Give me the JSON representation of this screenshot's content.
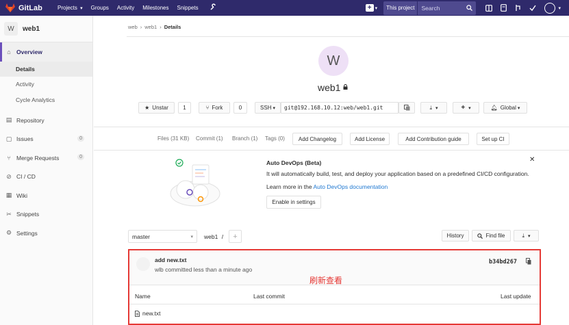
{
  "navbar": {
    "brand": "GitLab",
    "links": [
      "Projects",
      "Groups",
      "Activity",
      "Milestones",
      "Snippets"
    ],
    "scope": "This project",
    "search_placeholder": "Search",
    "bg_color": "#2f2a6b"
  },
  "sidebar": {
    "project_initial": "W",
    "project_name": "web1",
    "overview": "Overview",
    "sub_items": [
      "Details",
      "Activity",
      "Cycle Analytics"
    ],
    "items": [
      {
        "label": "Repository",
        "icon": "book-icon"
      },
      {
        "label": "Issues",
        "icon": "issues-icon",
        "count": "0"
      },
      {
        "label": "Merge Requests",
        "icon": "merge-request-icon",
        "count": "0"
      },
      {
        "label": "CI / CD",
        "icon": "rocket-icon"
      },
      {
        "label": "Wiki",
        "icon": "wiki-icon"
      },
      {
        "label": "Snippets",
        "icon": "scissors-icon"
      },
      {
        "label": "Settings",
        "icon": "gear-icon"
      }
    ]
  },
  "breadcrumb": [
    "web",
    "web1",
    "Details"
  ],
  "project": {
    "initial": "W",
    "title": "web1"
  },
  "actions": {
    "star_label": "Unstar",
    "star_count": "1",
    "fork_label": "Fork",
    "fork_count": "0",
    "protocol": "SSH",
    "clone_url": "git@192.168.10.12:web/web1.git",
    "notification": "Global"
  },
  "stats": {
    "files": "Files (31 KB)",
    "commits": "Commit (1)",
    "branches": "Branch (1)",
    "tags": "Tags (0)",
    "buttons": [
      "Add Changelog",
      "Add License",
      "Add Contribution guide",
      "Set up CI"
    ]
  },
  "devops": {
    "title": "Auto DevOps (Beta)",
    "text": "It will automatically build, test, and deploy your application based on a predefined CI/CD configuration.",
    "more_prefix": "Learn more in the ",
    "more_link": "Auto DevOps documentation",
    "button": "Enable in settings"
  },
  "repo": {
    "branch": "master",
    "path": "web1",
    "path_sep": "/",
    "history": "History",
    "find_file": "Find file"
  },
  "commit": {
    "title": "add new.txt",
    "meta": "wlb committed less than a minute ago",
    "sha": "b34bd267"
  },
  "annotation": "刷新查看",
  "table": {
    "headers": [
      "Name",
      "Last commit",
      "Last update"
    ],
    "files": [
      "new.txt"
    ]
  }
}
